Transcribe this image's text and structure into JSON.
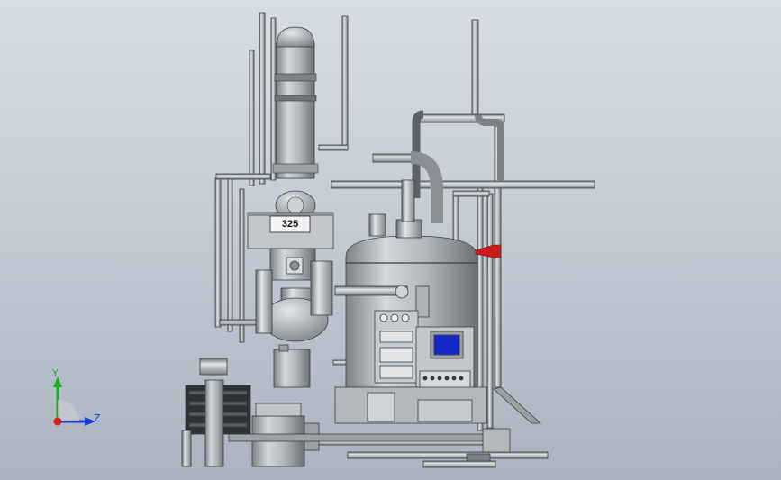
{
  "viewport": {
    "background_top": "#d7dde6",
    "background_bottom": "#aab3bf"
  },
  "model": {
    "component_label": "325",
    "colors": {
      "steel_light": "#dadde0",
      "steel_mid": "#a9adb1",
      "steel_dark": "#5c6166",
      "outline": "#3a3d40",
      "marker_red": "#cc1a1a",
      "panel_screen": "#1428c8"
    }
  },
  "triad": {
    "y_label": "Y",
    "z_label": "Z",
    "y_color": "#18b018",
    "z_color": "#1a3ad0",
    "origin_color": "#d42020"
  }
}
